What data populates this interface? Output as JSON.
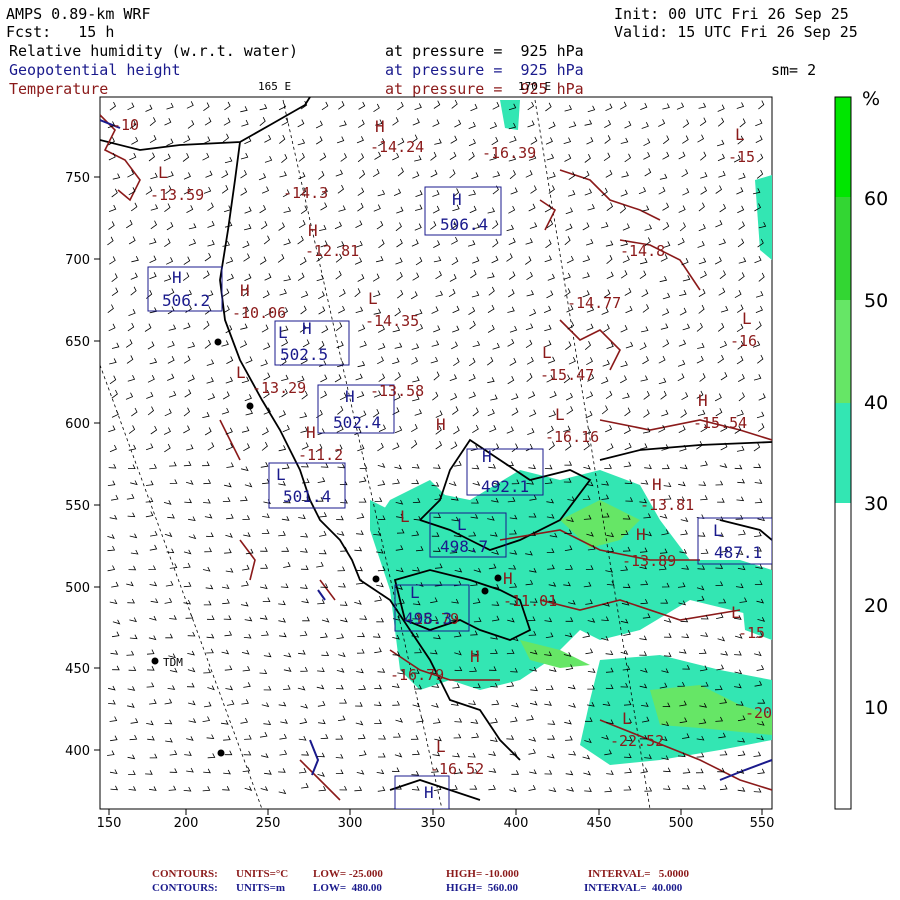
{
  "header": {
    "model": "AMPS 0.89-km WRF",
    "init": "Init: 00 UTC Fri 26 Sep 25",
    "fcst": "Fcst:   15 h",
    "valid": "Valid: 15 UTC Fri 26 Sep 25",
    "field1": "Relative humidity (w.r.t. water)",
    "field1_level": "at pressure =  925 hPa",
    "field2": "Geopotential height",
    "field2_level": "at pressure =  925 hPa",
    "field3": "Temperature",
    "field3_level": "at pressure =  925 hPa",
    "smooth": "sm= 2",
    "lon_label_1": "165 E",
    "lon_label_2": "170 E"
  },
  "axes": {
    "x_ticks": [
      "150",
      "200",
      "250",
      "300",
      "350",
      "400",
      "450",
      "500",
      "550"
    ],
    "y_ticks": [
      "750",
      "700",
      "650",
      "600",
      "550",
      "500",
      "450",
      "400"
    ]
  },
  "legend": {
    "unit": "%",
    "labels": [
      "60",
      "50",
      "40",
      "30",
      "20",
      "10"
    ],
    "colors": {
      "band_60_plus": "#00e600",
      "band_50_60": "#33d633",
      "band_40_50": "#66e666",
      "band_30_40": "#33e6b3",
      "below_30": "#ffffff"
    }
  },
  "map_labels": {
    "temps": [
      {
        "t": "-10"
      },
      {
        "t": "-13.59"
      },
      {
        "t": "-14.3"
      },
      {
        "t": "-14.24"
      },
      {
        "t": "-16.39"
      },
      {
        "t": "-15"
      },
      {
        "t": "-12.81"
      },
      {
        "t": "-10.06"
      },
      {
        "t": "-14.35"
      },
      {
        "t": "-14.8"
      },
      {
        "t": "-14.77"
      },
      {
        "t": "-16"
      },
      {
        "t": "-13.29"
      },
      {
        "t": "-13.58"
      },
      {
        "t": "-15.47"
      },
      {
        "t": "-15.54"
      },
      {
        "t": "-16.16"
      },
      {
        "t": "-11.2"
      },
      {
        "t": "-13.81"
      },
      {
        "t": "-13.89"
      },
      {
        "t": "-15"
      },
      {
        "t": "-11.01"
      },
      {
        "t": "-15.79"
      },
      {
        "t": "-16.79"
      },
      {
        "t": "-20"
      },
      {
        "t": "-22.52"
      },
      {
        "t": "-16.52"
      }
    ],
    "heights": [
      {
        "t": "506.4"
      },
      {
        "t": "506.2"
      },
      {
        "t": "502.5"
      },
      {
        "t": "502.4"
      },
      {
        "t": "501.4"
      },
      {
        "t": "492.1"
      },
      {
        "t": "498.7"
      },
      {
        "t": "487.1"
      },
      {
        "t": "498.3"
      }
    ],
    "station": "TDM"
  },
  "footer": {
    "line1": {
      "contours": "CONTOURS:",
      "units": "UNITS=°C",
      "low": "LOW= -25.000",
      "high": "HIGH= -10.000",
      "interval": "INTERVAL=   5.0000"
    },
    "line2": {
      "contours": "CONTOURS:",
      "units": "UNITS=m",
      "low": "LOW=  480.00",
      "high": "HIGH=  560.00",
      "interval": "INTERVAL=  40.000"
    }
  }
}
